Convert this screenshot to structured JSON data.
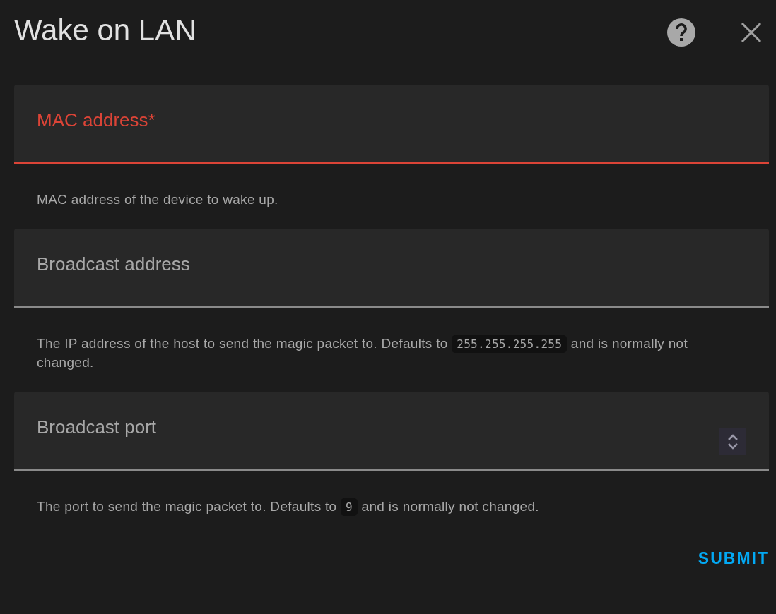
{
  "dialog": {
    "title": "Wake on LAN"
  },
  "fields": [
    {
      "kind": "text",
      "label": "MAC address*",
      "invalid": true,
      "helper": [
        {
          "kind": "text",
          "text": "MAC address of the device to wake up."
        }
      ]
    },
    {
      "kind": "text",
      "label": "Broadcast address",
      "invalid": false,
      "helper": [
        {
          "kind": "text",
          "text": "The IP address of the host to send the magic packet to. Defaults to "
        },
        {
          "kind": "code",
          "text": "255.255.255.255"
        },
        {
          "kind": "text",
          "text": " and is normally not changed."
        }
      ]
    },
    {
      "kind": "number",
      "label": "Broadcast port",
      "invalid": false,
      "helper": [
        {
          "kind": "text",
          "text": "The port to send the magic packet to. Defaults to "
        },
        {
          "kind": "code",
          "text": "9"
        },
        {
          "kind": "text",
          "text": " and is normally not changed."
        }
      ]
    }
  ],
  "submit": "SUBMIT"
}
